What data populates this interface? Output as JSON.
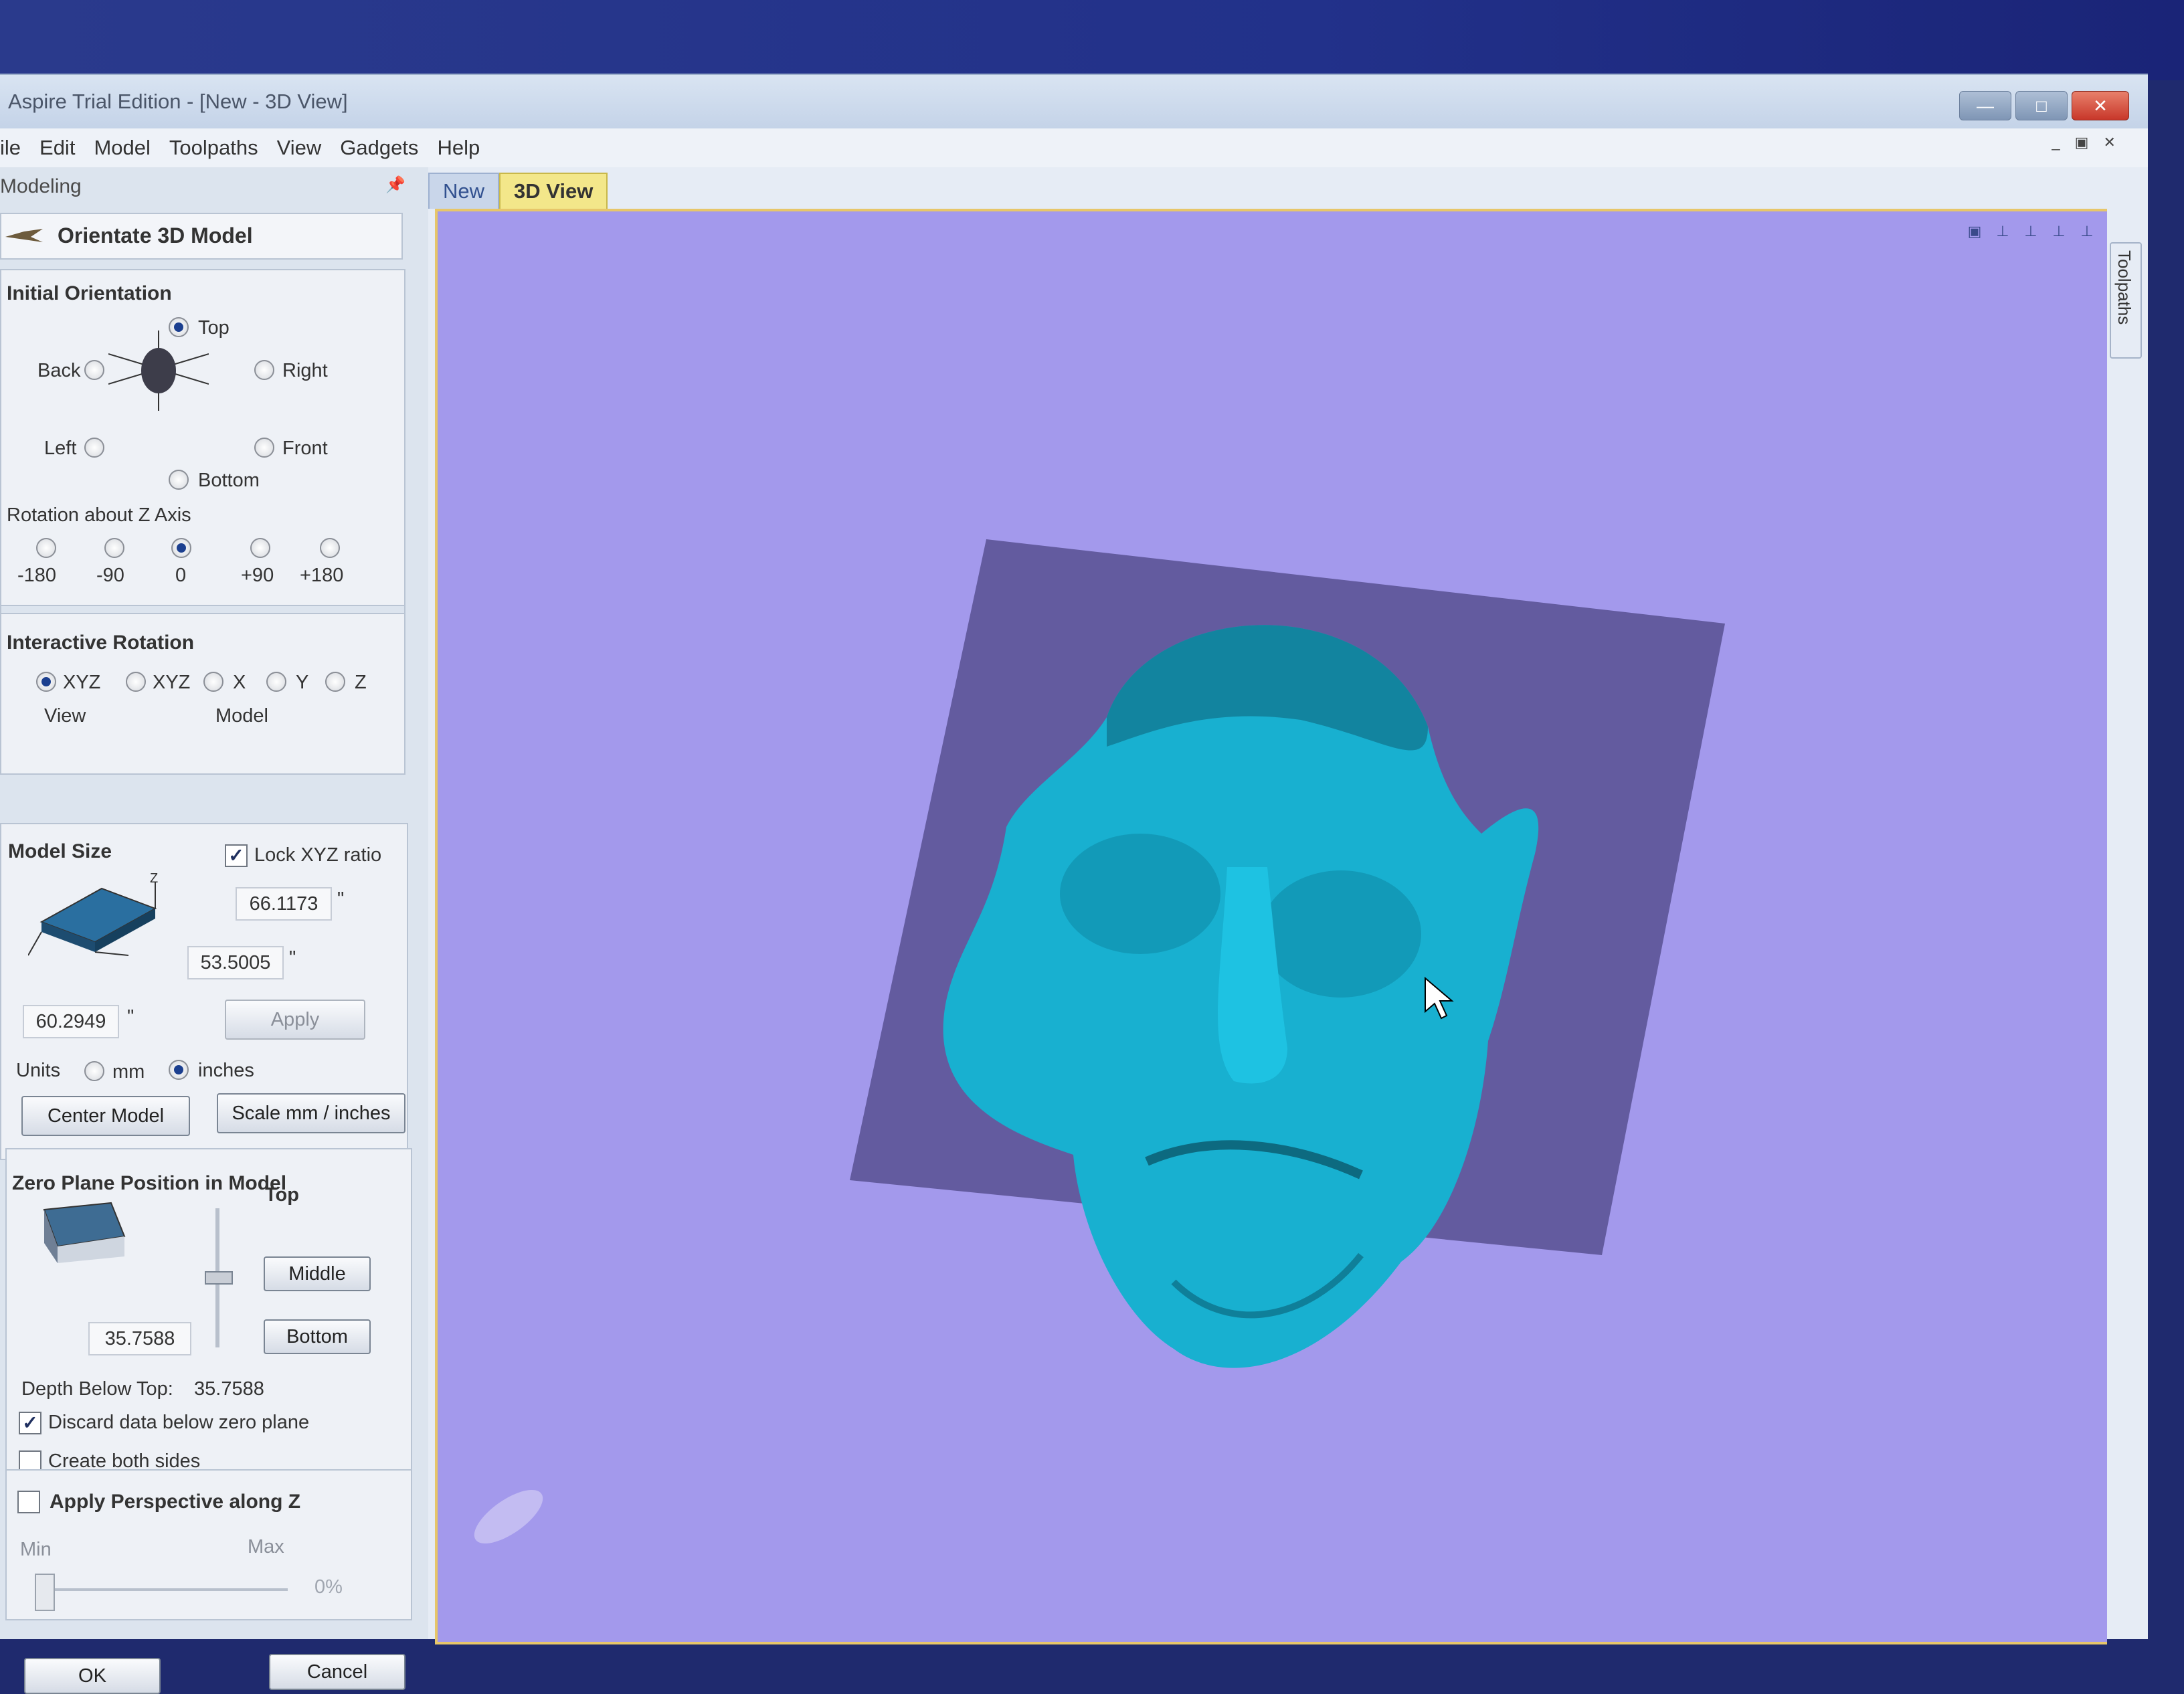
{
  "window": {
    "title": "Aspire Trial Edition - [New - 3D View]"
  },
  "menu": [
    "ile",
    "Edit",
    "Model",
    "Toolpaths",
    "View",
    "Gadgets",
    "Help"
  ],
  "panel": {
    "header": "Modeling",
    "title": "Orientate 3D Model",
    "initial_orientation": {
      "title": "Initial Orientation",
      "top": "Top",
      "back": "Back",
      "right": "Right",
      "left": "Left",
      "front": "Front",
      "bottom": "Bottom",
      "selected": "Top"
    },
    "rotation_z": {
      "title": "Rotation about Z Axis",
      "options": [
        "-180",
        "-90",
        "0",
        "+90",
        "+180"
      ],
      "selected": "0"
    },
    "interactive_rotation": {
      "title": "Interactive Rotation",
      "options": [
        "XYZ",
        "XYZ",
        "X",
        "Y",
        "Z"
      ],
      "view_label": "View",
      "model_label": "Model",
      "selected_index": 0
    },
    "model_size": {
      "title": "Model Size",
      "lock_label": "Lock XYZ ratio",
      "lock_checked": true,
      "y_value": "66.1173",
      "x_value": "53.5005",
      "z_value": "60.2949",
      "unit_mark": "\"",
      "apply_label": "Apply",
      "units_label": "Units",
      "mm_label": "mm",
      "inches_label": "inches",
      "units_selected": "inches",
      "center_label": "Center Model",
      "scale_label": "Scale mm / inches"
    },
    "zero_plane": {
      "title": "Zero Plane Position in Model",
      "top_label": "Top",
      "middle_label": "Middle",
      "bottom_label": "Bottom",
      "value": "35.7588",
      "depth_label": "Depth Below Top:",
      "depth_value": "35.7588",
      "discard_label": "Discard data below zero plane",
      "discard_checked": true,
      "both_label": "Create both sides",
      "both_checked": false
    },
    "perspective": {
      "title": "Apply Perspective along Z",
      "checked": false,
      "min_label": "Min",
      "max_label": "Max",
      "value_label": "0%",
      "value": 0
    },
    "ok_label": "OK",
    "cancel_label": "Cancel"
  },
  "tabs": [
    {
      "label": "New",
      "active": false
    },
    {
      "label": "3D View",
      "active": true
    }
  ],
  "side_tab": "Toolpaths",
  "colors": {
    "viewport": "#a399ec",
    "model": "#18b0d0",
    "plane": "#5c5497"
  }
}
